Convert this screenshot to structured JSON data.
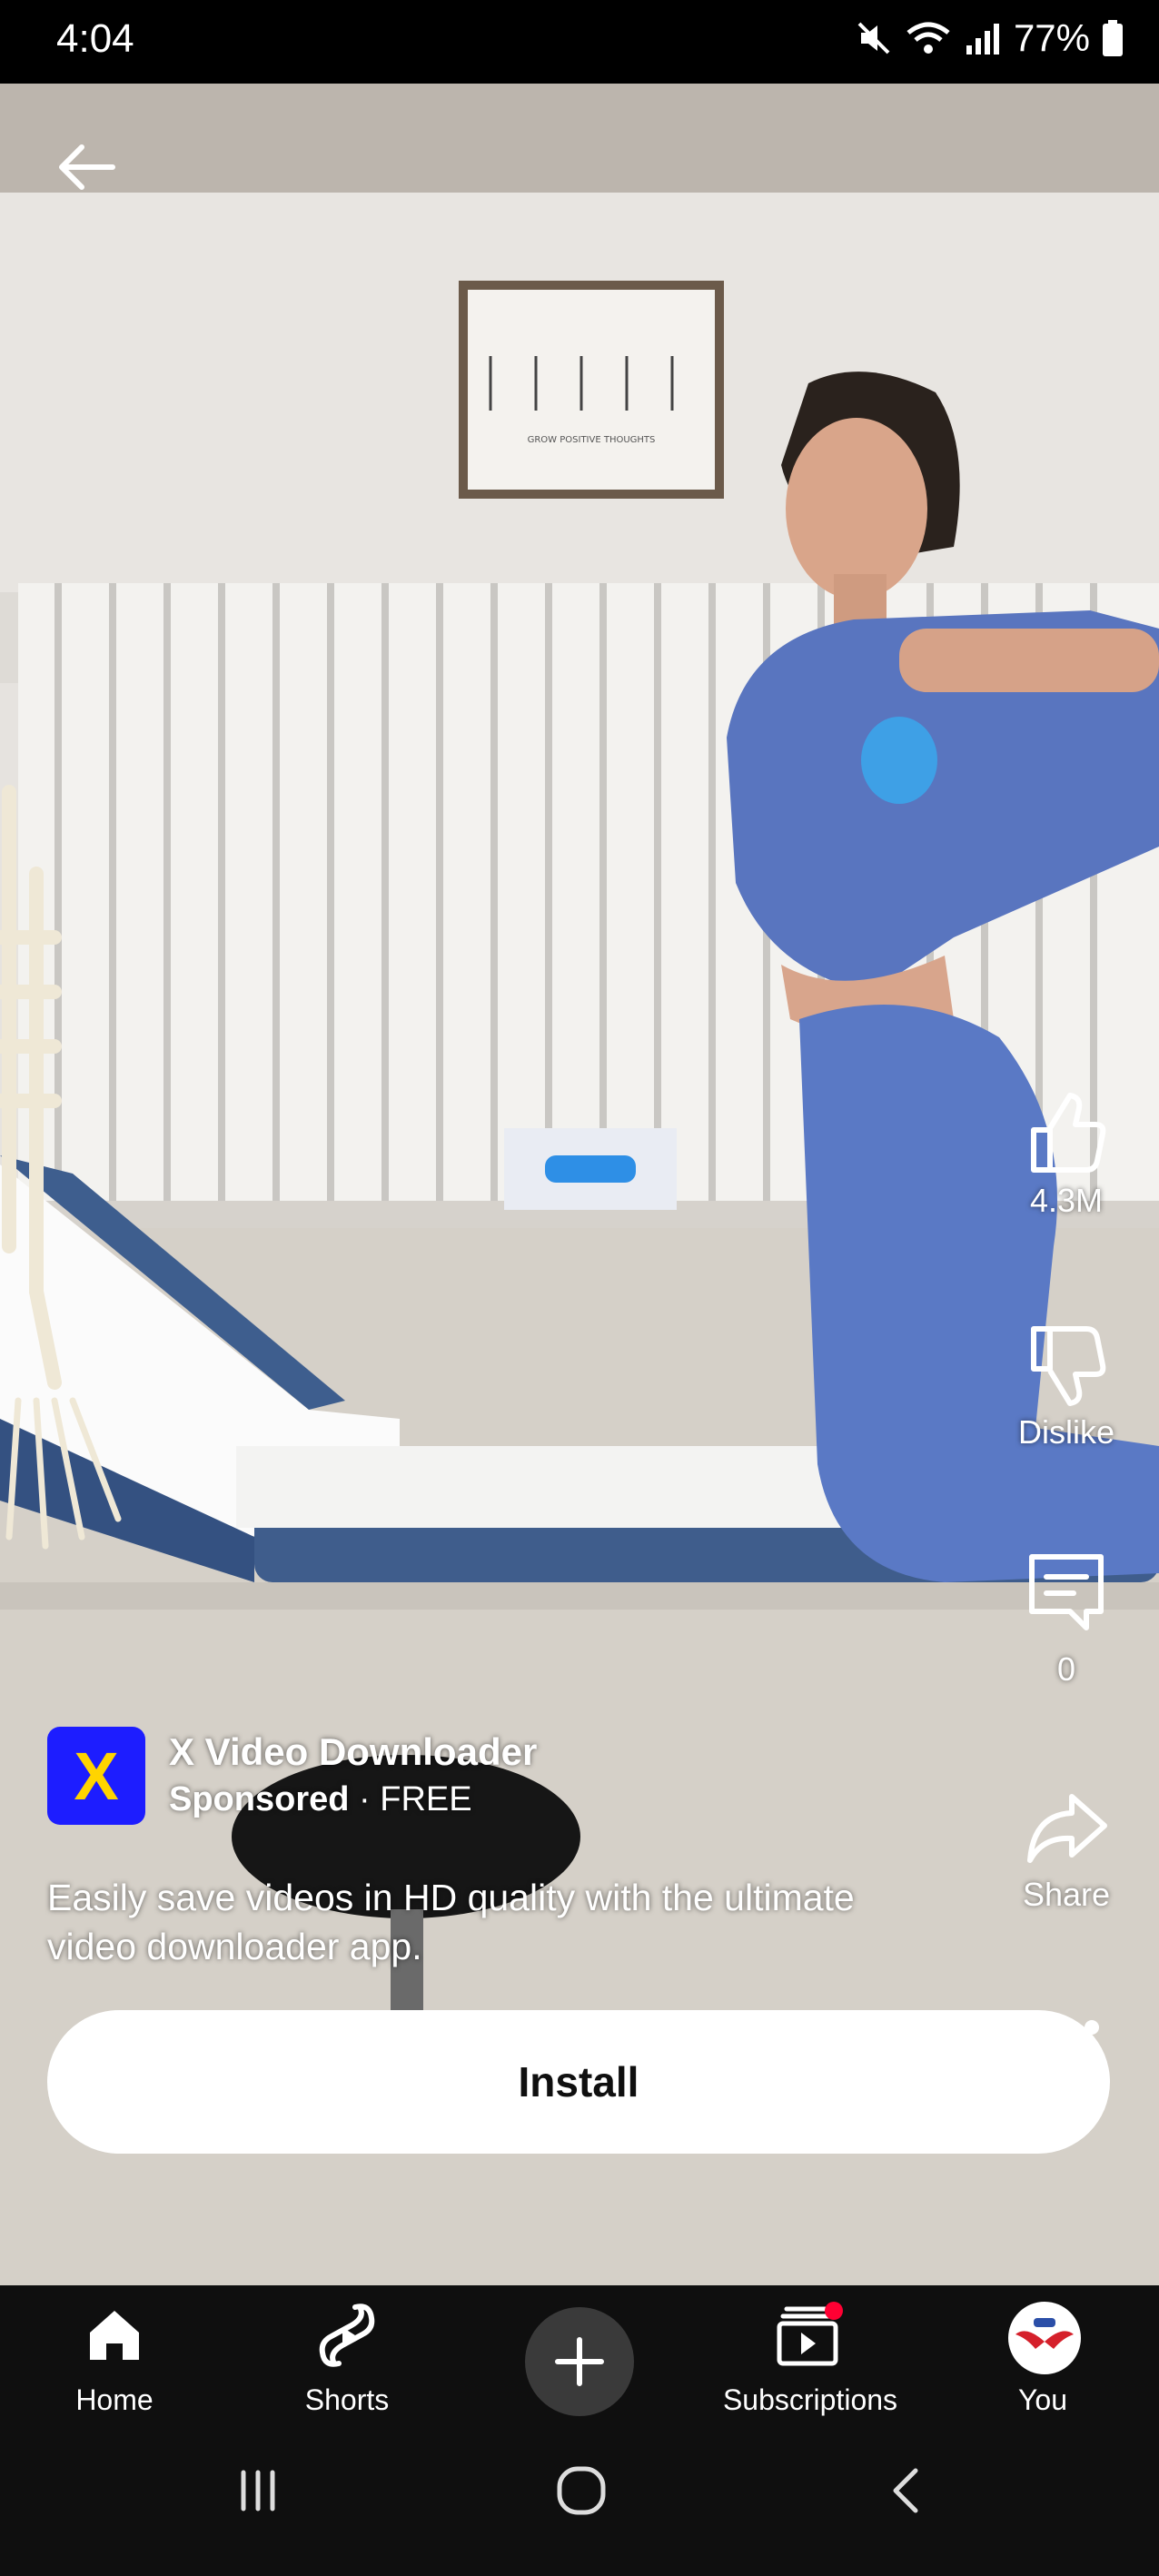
{
  "status_bar": {
    "time": "4:04",
    "battery": "77%"
  },
  "actions": {
    "like_count": "4.3M",
    "dislike_label": "Dislike",
    "comment_count": "0",
    "share_label": "Share"
  },
  "ad": {
    "logo_letter": "X",
    "title": "X Video Downloader",
    "sponsored": "Sponsored",
    "price": "· FREE",
    "description": "Easily save videos in HD quality with the ultimate video downloader app.",
    "install_label": "Install"
  },
  "poster": {
    "text": "GROW POSITIVE THOUGHTS"
  },
  "nav": {
    "home": "Home",
    "shorts": "Shorts",
    "subscriptions": "Subscriptions",
    "you": "You"
  },
  "colors": {
    "ad_logo_bg": "#1d1dff",
    "ad_logo_letter": "#ffd400",
    "badge": "#ff0033"
  }
}
